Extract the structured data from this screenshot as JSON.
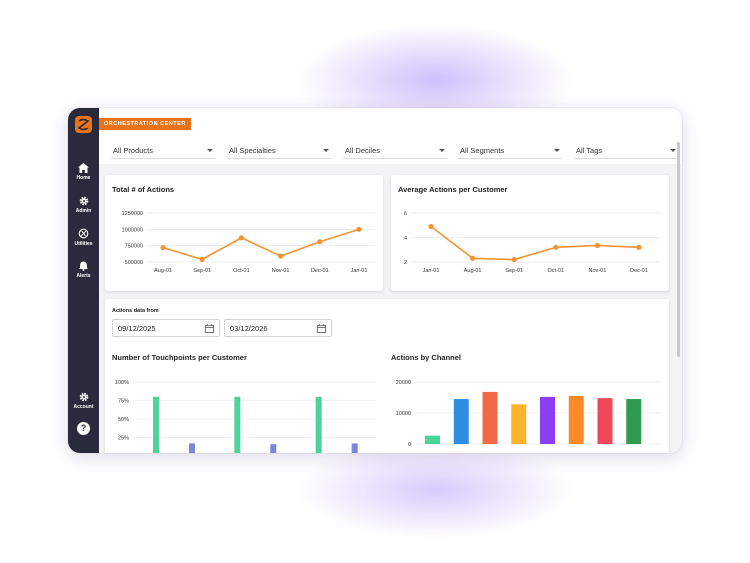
{
  "sidebar": {
    "items": [
      {
        "label": "Home",
        "icon": "home-icon"
      },
      {
        "label": "Admin",
        "icon": "gear-icon"
      },
      {
        "label": "Utilities",
        "icon": "utilities-icon"
      },
      {
        "label": "Alerts",
        "icon": "bell-icon"
      },
      {
        "label": "Account",
        "icon": "gear-icon"
      }
    ],
    "help_label": "?"
  },
  "header": {
    "brand": "ORCHESTRATION CENTER"
  },
  "filters": [
    {
      "label": "All Products"
    },
    {
      "label": "All Specialties"
    },
    {
      "label": "All Deciles"
    },
    {
      "label": "All Segments"
    },
    {
      "label": "All Tags"
    }
  ],
  "date_range": {
    "label": "Actions data from",
    "start": "09/12/2025",
    "end": "03/12/2026"
  },
  "colors": {
    "accent": "#e8741a",
    "sidebar": "#2a2a3a",
    "line": "#f29432"
  },
  "chart_data": [
    {
      "type": "line",
      "title": "Total # of Actions",
      "categories": [
        "Aug-01",
        "Sep-01",
        "Oct-01",
        "Nov-01",
        "Dec-01",
        "Jan-01"
      ],
      "values": [
        720000,
        540000,
        870000,
        590000,
        810000,
        1000000
      ],
      "yticks": [
        "1250000",
        "1000000",
        "750000",
        "500000"
      ],
      "ylim": [
        500000,
        1250000
      ],
      "grid": true
    },
    {
      "type": "line",
      "title": "Average Actions per Customer",
      "categories": [
        "Jan-01",
        "Aug-01",
        "Sep-01",
        "Oct-01",
        "Nov-01",
        "Dec-01"
      ],
      "values": [
        4.9,
        2.3,
        2.2,
        3.2,
        3.35,
        3.2
      ],
      "yticks": [
        "6",
        "4",
        "2"
      ],
      "ylim": [
        2,
        6
      ],
      "grid": true
    },
    {
      "type": "bar",
      "title": "Number of Touchpoints per Customer",
      "yticks": [
        "100%",
        "75%",
        "50%",
        "25%",
        "0%"
      ],
      "ylim": [
        0,
        100
      ],
      "groups": 3,
      "series": [
        {
          "values": [
            80,
            80,
            80
          ],
          "color": "#4cd39b"
        },
        {
          "values": [
            17,
            16,
            17
          ],
          "color": "#7b86d8"
        }
      ]
    },
    {
      "type": "bar",
      "title": "Actions by Channel",
      "yticks": [
        "20000",
        "10000",
        "0"
      ],
      "ylim": [
        0,
        20000
      ],
      "values": [
        2700,
        14500,
        16800,
        12800,
        15200,
        15500,
        14800,
        14500
      ],
      "colors": [
        "#4cd39b",
        "#2f8de4",
        "#f06a48",
        "#fdb32a",
        "#8a3ff3",
        "#ff8a2a",
        "#f0475a",
        "#2e9b4d"
      ]
    }
  ]
}
